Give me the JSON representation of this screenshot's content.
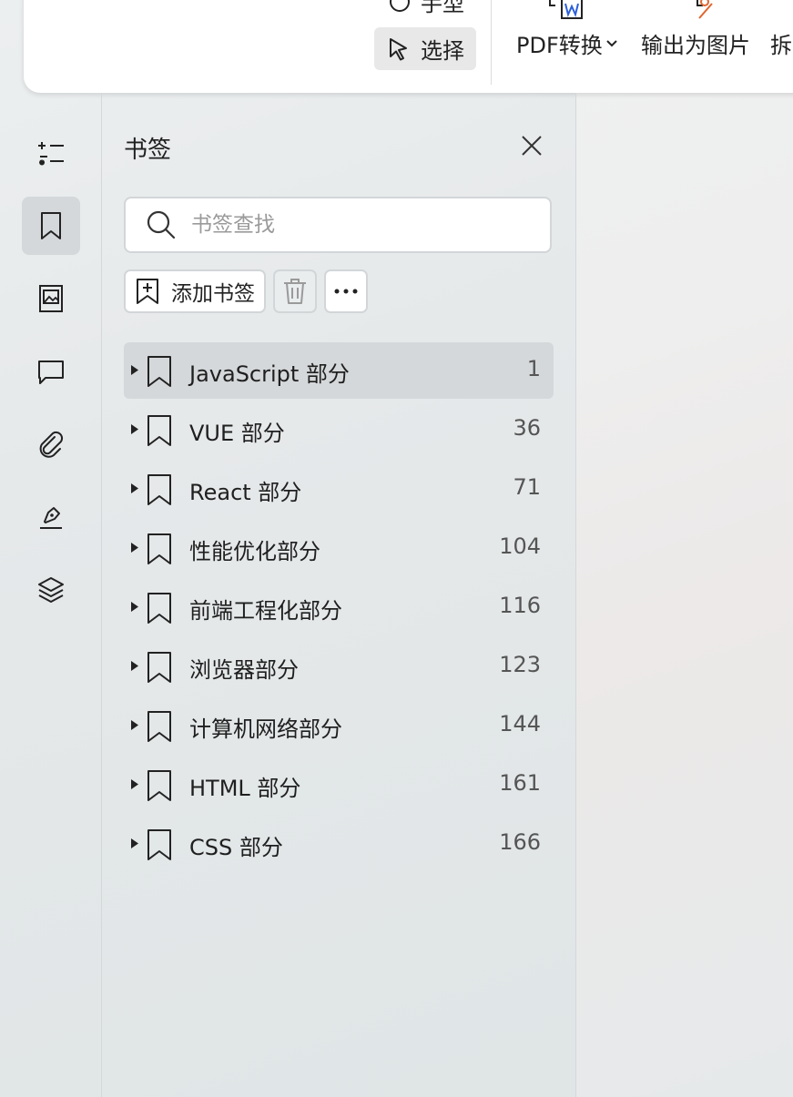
{
  "ribbon": {
    "hand_label": "手型",
    "select_label": "选择",
    "pdf_convert_label": "PDF转换",
    "export_image_label": "输出为图片",
    "split_label": "拆分"
  },
  "sidebar": {
    "items": [
      {
        "name": "outline-icon"
      },
      {
        "name": "bookmark-icon",
        "active": true
      },
      {
        "name": "thumbnail-icon"
      },
      {
        "name": "comment-icon"
      },
      {
        "name": "attachment-icon"
      },
      {
        "name": "signature-icon"
      },
      {
        "name": "layers-icon"
      }
    ]
  },
  "panel": {
    "title": "书签",
    "search_placeholder": "书签查找",
    "search_value": "",
    "add_bookmark_label": "添加书签",
    "bookmarks": [
      {
        "label": "JavaScript 部分",
        "page": "1",
        "selected": true
      },
      {
        "label": "VUE 部分",
        "page": "36"
      },
      {
        "label": "React 部分",
        "page": "71"
      },
      {
        "label": "性能优化部分",
        "page": "104"
      },
      {
        "label": "前端工程化部分",
        "page": "116"
      },
      {
        "label": "浏览器部分",
        "page": "123"
      },
      {
        "label": "计算机网络部分",
        "page": "144"
      },
      {
        "label": "HTML 部分",
        "page": "161"
      },
      {
        "label": "CSS 部分",
        "page": "166"
      }
    ]
  }
}
